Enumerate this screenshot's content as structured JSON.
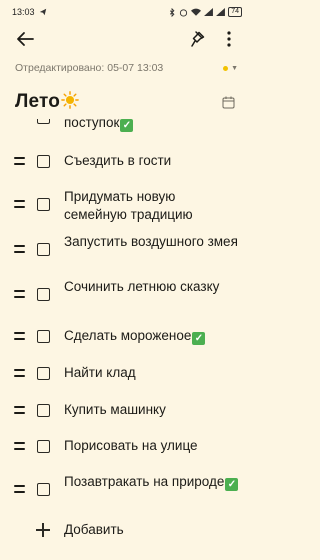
{
  "status_bar": {
    "time": "13:03",
    "battery": "74"
  },
  "toolbar": {
    "back_icon": "arrow-left-icon",
    "pin_icon": "pin-icon",
    "more_icon": "more-vert-icon"
  },
  "note": {
    "edited": "Отредактировано: 05-07 13:03",
    "title": "Лето",
    "title_emoji": "sun-icon",
    "color": "#f2c200"
  },
  "checklist": {
    "items": [
      {
        "text": "поступок",
        "checked": false,
        "emoji_check": true
      },
      {
        "text": "Съездить в гости",
        "checked": false,
        "emoji_check": false
      },
      {
        "text": "Придумать новую семейную традицию",
        "checked": false,
        "emoji_check": false
      },
      {
        "text": "Запустить воздушного змея",
        "checked": false,
        "emoji_check": false
      },
      {
        "text": "Сочинить летнюю сказку",
        "checked": false,
        "emoji_check": false
      },
      {
        "text": "Сделать мороженое",
        "checked": false,
        "emoji_check": true
      },
      {
        "text": "Найти клад",
        "checked": false,
        "emoji_check": false
      },
      {
        "text": "Купить машинку",
        "checked": false,
        "emoji_check": false
      },
      {
        "text": "Порисовать на улице",
        "checked": false,
        "emoji_check": false
      },
      {
        "text": "Позавтракать на природе",
        "checked": false,
        "emoji_check": true
      }
    ],
    "add_label": "Добавить"
  }
}
